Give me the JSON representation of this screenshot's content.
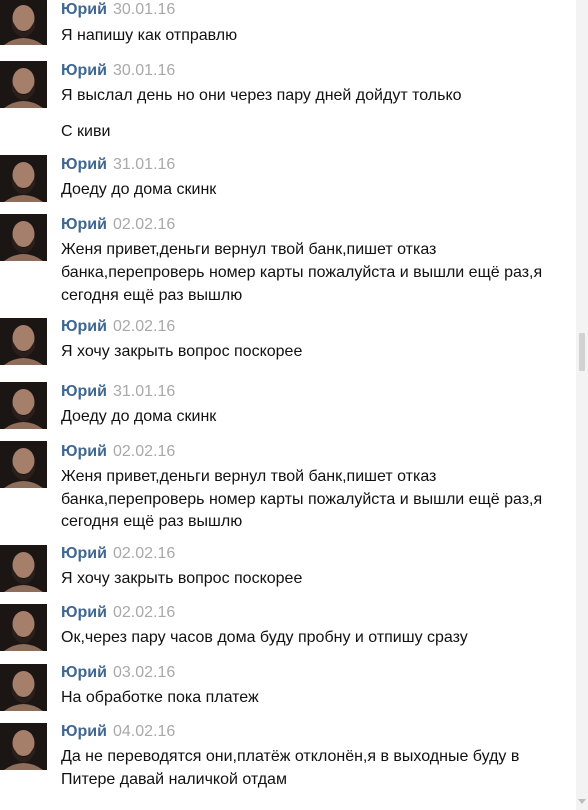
{
  "messages": [
    {
      "author": "Юрий",
      "date": "30.01.16",
      "lines": [
        "Я напишу как отправлю"
      ],
      "avatar_icon": "bearded-man-avatar"
    },
    {
      "author": "Юрий",
      "date": "30.01.16",
      "lines": [
        "Я выслал день но они через пару дней дойдут только",
        "",
        "С киви"
      ],
      "avatar_icon": "bearded-man-avatar"
    },
    {
      "author": "Юрий",
      "date": "31.01.16",
      "lines": [
        "Доеду до дома скинк"
      ],
      "avatar_icon": "bearded-man-avatar"
    },
    {
      "author": "Юрий",
      "date": "02.02.16",
      "lines": [
        "Женя привет,деньги вернул твой банк,пишет отказ",
        "банка,перепроверь номер карты пожалуйста и вышли ещё раз,я",
        "сегодня ещё раз вышлю"
      ],
      "avatar_icon": "bearded-man-avatar"
    },
    {
      "author": "Юрий",
      "date": "02.02.16",
      "lines": [
        "Я хочу закрыть вопрос поскорее"
      ],
      "avatar_icon": "bearded-man-avatar"
    },
    {
      "author": "Юрий",
      "date": "31.01.16",
      "lines": [
        "Доеду до дома скинк"
      ],
      "avatar_icon": "bearded-man-avatar"
    },
    {
      "author": "Юрий",
      "date": "02.02.16",
      "lines": [
        "Женя привет,деньги вернул твой банк,пишет отказ",
        "банка,перепроверь номер карты пожалуйста и вышли ещё раз,я",
        "сегодня ещё раз вышлю"
      ],
      "avatar_icon": "bearded-man-avatar"
    },
    {
      "author": "Юрий",
      "date": "02.02.16",
      "lines": [
        "Я хочу закрыть вопрос поскорее"
      ],
      "avatar_icon": "bearded-man-avatar"
    },
    {
      "author": "Юрий",
      "date": "02.02.16",
      "lines": [
        "Ок,через пару часов дома буду пробну и отпишу сразу"
      ],
      "avatar_icon": "bearded-man-avatar"
    },
    {
      "author": "Юрий",
      "date": "03.02.16",
      "lines": [
        "На обработке пока платеж"
      ],
      "avatar_icon": "bearded-man-avatar"
    },
    {
      "author": "Юрий",
      "date": "04.02.16",
      "lines": [
        "Да не переводятся они,платёж отклонён,я в выходные буду в",
        "Питере давай наличкой отдам"
      ],
      "avatar_icon": "bearded-man-avatar"
    }
  ],
  "colors": {
    "author": "#3f6791",
    "date": "#a9a9a9",
    "text": "#111111",
    "background": "#ffffff"
  }
}
